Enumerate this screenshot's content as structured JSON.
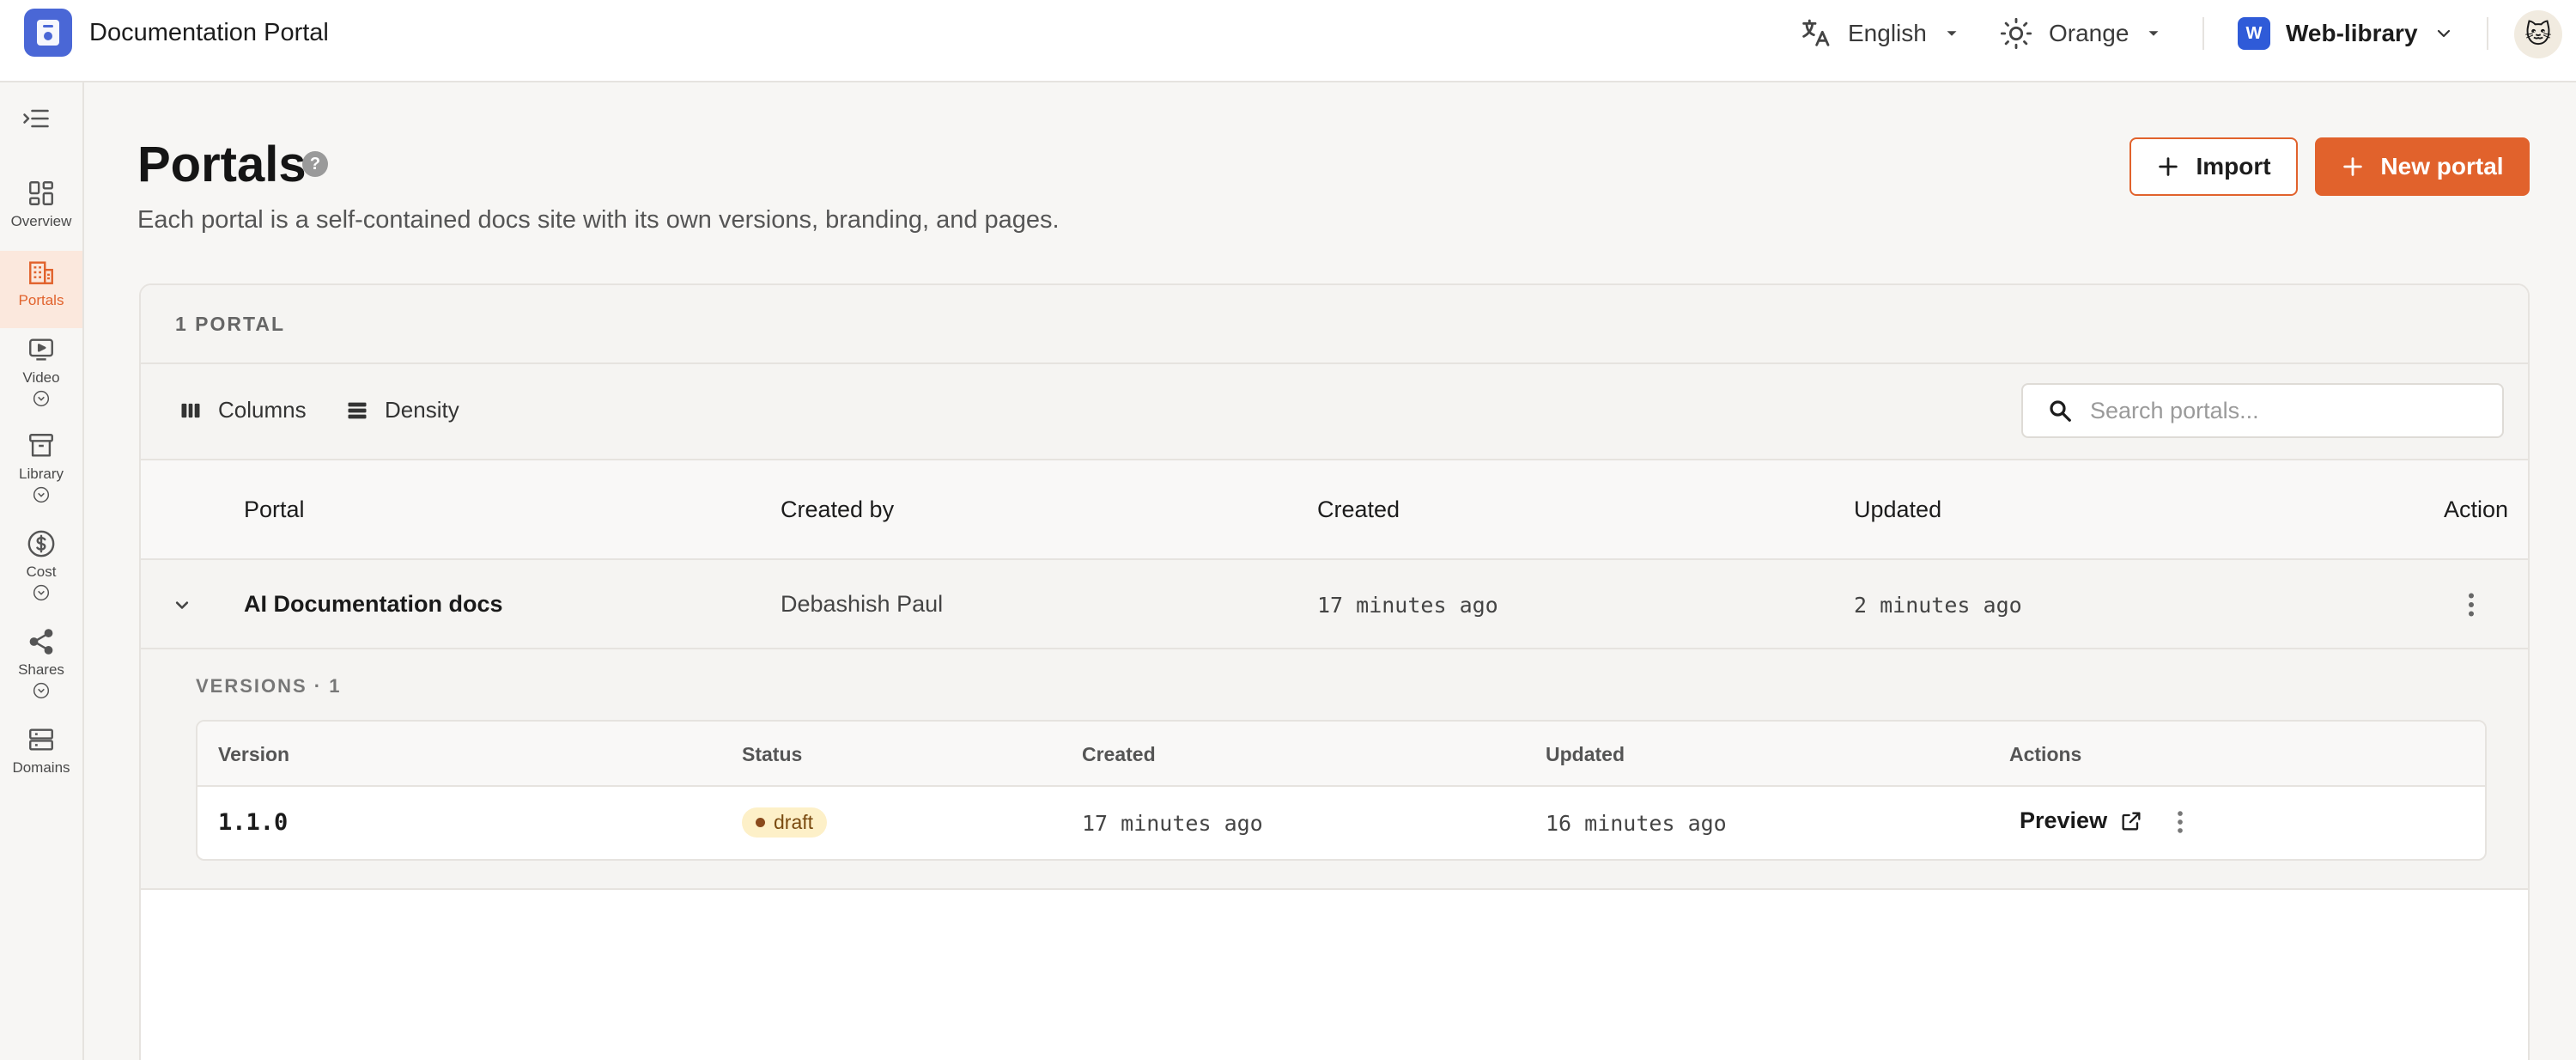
{
  "app": {
    "title": "Documentation Portal"
  },
  "topbar": {
    "language": "English",
    "theme": "Orange",
    "workspace_badge": "W",
    "workspace": "Web-library",
    "avatar_emoji": "🐱"
  },
  "sidebar": {
    "items": [
      {
        "label": "Overview",
        "icon": "grid-icon"
      },
      {
        "label": "Portals",
        "icon": "building-icon",
        "active": true
      },
      {
        "label": "Video",
        "icon": "video-icon"
      },
      {
        "label": "Library",
        "icon": "archive-icon"
      },
      {
        "label": "Cost",
        "icon": "dollar-icon"
      },
      {
        "label": "Shares",
        "icon": "share-icon"
      },
      {
        "label": "Domains",
        "icon": "server-icon"
      }
    ]
  },
  "page": {
    "title": "Portals",
    "help": "?",
    "subtitle": "Each portal is a self-contained docs site with its own versions, branding, and pages.",
    "import_label": "Import",
    "new_label": "New portal"
  },
  "panel": {
    "count": "1 PORTAL",
    "columns_label": "Columns",
    "density_label": "Density",
    "search_placeholder": "Search portals...",
    "headers": {
      "portal": "Portal",
      "created_by": "Created by",
      "created": "Created",
      "updated": "Updated",
      "action": "Action"
    },
    "rows": [
      {
        "portal": "AI Documentation docs",
        "created_by": "Debashish Paul",
        "created": "17 minutes ago",
        "updated": "2 minutes ago"
      }
    ]
  },
  "versions": {
    "label": "VERSIONS · 1",
    "headers": {
      "version": "Version",
      "status": "Status",
      "created": "Created",
      "updated": "Updated",
      "actions": "Actions"
    },
    "rows": [
      {
        "version": "1.1.0",
        "status": "draft",
        "created": "17 minutes ago",
        "updated": "16 minutes ago",
        "preview": "Preview"
      }
    ]
  },
  "colors": {
    "accent": "#e1622c",
    "badge_bg": "#fdf0c8",
    "logo": "#4a67d6",
    "workspace": "#2f5bd8"
  }
}
